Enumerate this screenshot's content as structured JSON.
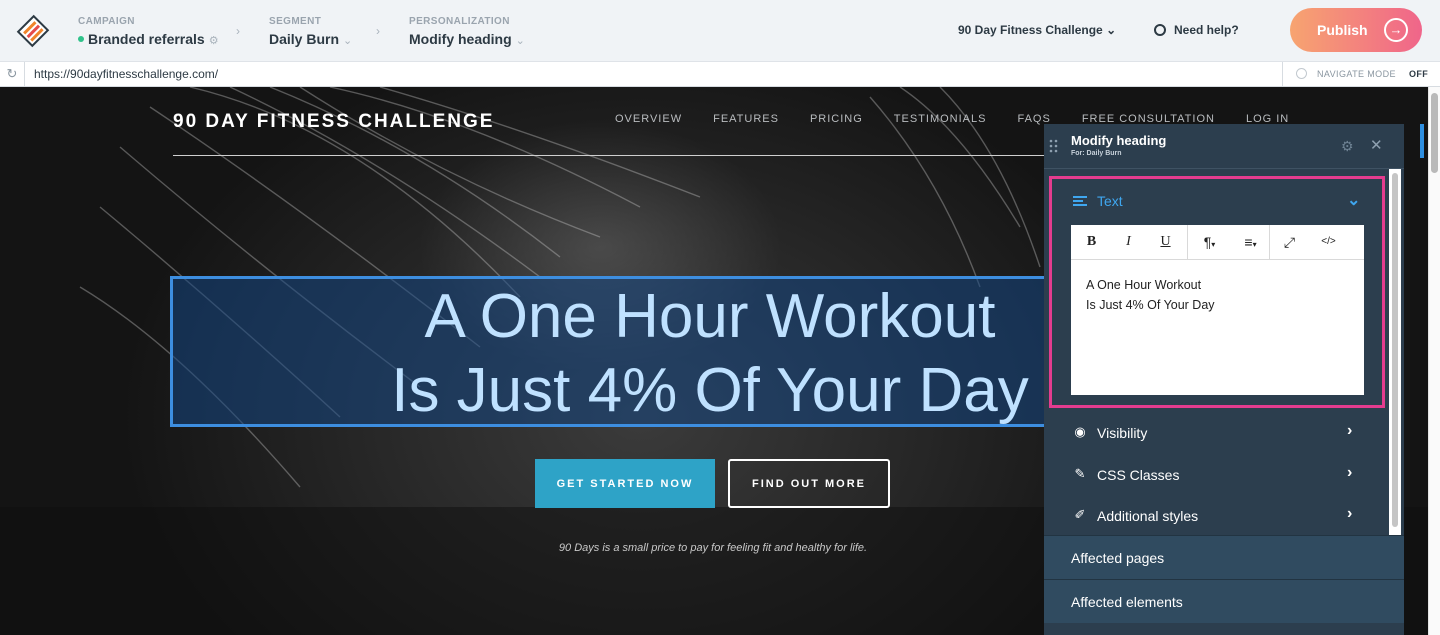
{
  "topbar": {
    "crumbs": [
      {
        "label": "CAMPAIGN",
        "value": "Branded referrals"
      },
      {
        "label": "SEGMENT",
        "value": "Daily Burn"
      },
      {
        "label": "PERSONALIZATION",
        "value": "Modify heading"
      }
    ],
    "site_select": "90 Day Fitness Challenge",
    "help": "Need help?",
    "publish": "Publish"
  },
  "urlbar": {
    "url": "https://90dayfitnesschallenge.com/",
    "navigate_mode_label": "NAVIGATE MODE",
    "navigate_mode_state": "OFF"
  },
  "site": {
    "title": "90 DAY FITNESS CHALLENGE",
    "nav": [
      "OVERVIEW",
      "FEATURES",
      "PRICING",
      "TESTIMONIALS",
      "FAQS",
      "FREE CONSULTATION",
      "LOG IN"
    ],
    "heading_line1": "A One Hour Workout",
    "heading_line2": "Is Just 4% Of Your Day",
    "btn_start": "GET STARTED NOW",
    "btn_more": "FIND OUT MORE",
    "tagline": "90 Days is a small price to pay for feeling fit and healthy for life."
  },
  "panel": {
    "title": "Modify heading",
    "subtitle": "For: Daily Burn",
    "text_section": "Text",
    "toolbar": {
      "bold": "B",
      "italic": "I",
      "underline": "U",
      "paragraph": "¶",
      "align": "≡",
      "expand": "⤢",
      "code": "</>"
    },
    "editor_line1": "A One Hour Workout",
    "editor_line2": "Is Just 4% Of Your Day",
    "sections": [
      "Visibility",
      "CSS Classes",
      "Additional styles"
    ],
    "footer": [
      "Affected pages",
      "Affected elements"
    ]
  },
  "colors": {
    "accent": "#3fa7f0",
    "highlight": "#e43c8f",
    "publish_start": "#f7a470",
    "publish_end": "#f0658a",
    "cta": "#2ea3c7"
  }
}
